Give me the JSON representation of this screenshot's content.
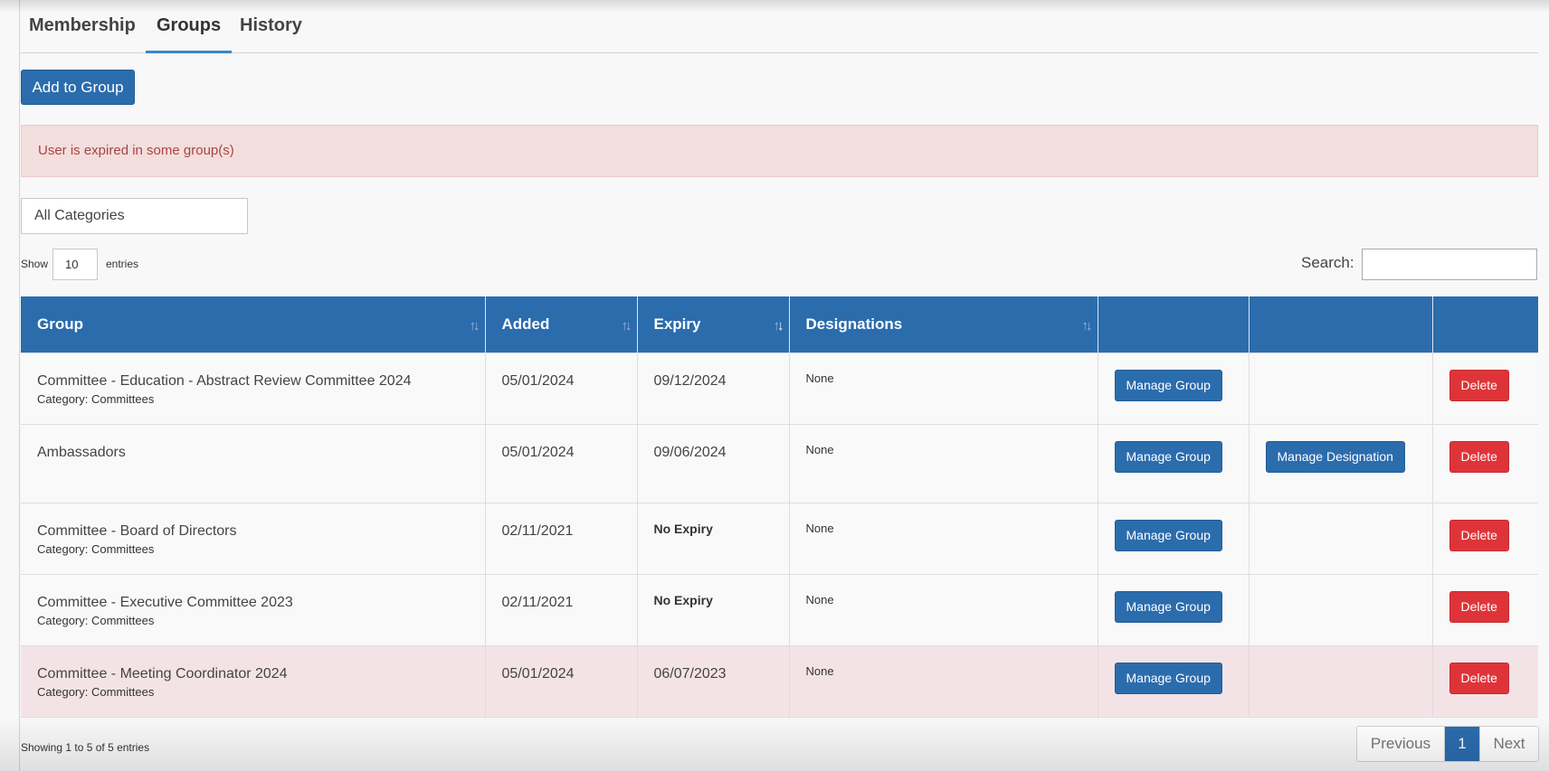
{
  "tabs": [
    {
      "label": "Membership",
      "active": false
    },
    {
      "label": "Groups",
      "active": true
    },
    {
      "label": "History",
      "active": false
    }
  ],
  "actions": {
    "add_label": "Add to Group"
  },
  "alert": {
    "text": "User is expired in some group(s)"
  },
  "filter": {
    "category_value": "All Categories"
  },
  "length": {
    "show_label": "Show",
    "value": "10",
    "entries_label": "entries"
  },
  "search": {
    "label": "Search:",
    "value": ""
  },
  "table": {
    "headers": [
      "Group",
      "Added",
      "Expiry",
      "Designations",
      "",
      "",
      ""
    ],
    "rows": [
      {
        "group": "Committee - Education - Abstract Review Committee 2024",
        "category": "Category: Committees",
        "added": "05/01/2024",
        "expiry": "09/12/2024",
        "designations": "None",
        "manage_group": "Manage Group",
        "manage_designation": "",
        "delete": "Delete"
      },
      {
        "group": "Ambassadors",
        "category": "",
        "added": "05/01/2024",
        "expiry": "09/06/2024",
        "designations": "None",
        "manage_group": "Manage Group",
        "manage_designation": "Manage Designation",
        "delete": "Delete"
      },
      {
        "group": "Committee - Board of Directors",
        "category": "Category: Committees",
        "added": "02/11/2021",
        "expiry": "No Expiry",
        "designations": "None",
        "manage_group": "Manage Group",
        "manage_designation": "",
        "delete": "Delete"
      },
      {
        "group": "Committee - Executive Committee 2023",
        "category": "Category: Committees",
        "added": "02/11/2021",
        "expiry": "No Expiry",
        "designations": "None",
        "manage_group": "Manage Group",
        "manage_designation": "",
        "delete": "Delete"
      },
      {
        "group": "Committee - Meeting Coordinator 2024",
        "category": "Category: Committees",
        "added": "05/01/2024",
        "expiry": "06/07/2023",
        "designations": "None",
        "manage_group": "Manage Group",
        "manage_designation": "",
        "delete": "Delete"
      }
    ]
  },
  "footer": {
    "info": "Showing 1 to 5 of 5 entries",
    "previous": "Previous",
    "current_page": "1",
    "next": "Next"
  },
  "colors": {
    "primary": "#2b6cad",
    "danger": "#de3439",
    "alert_bg": "#f3dede",
    "alert_text": "#a94442",
    "expired_row": "#f4e3e6"
  }
}
